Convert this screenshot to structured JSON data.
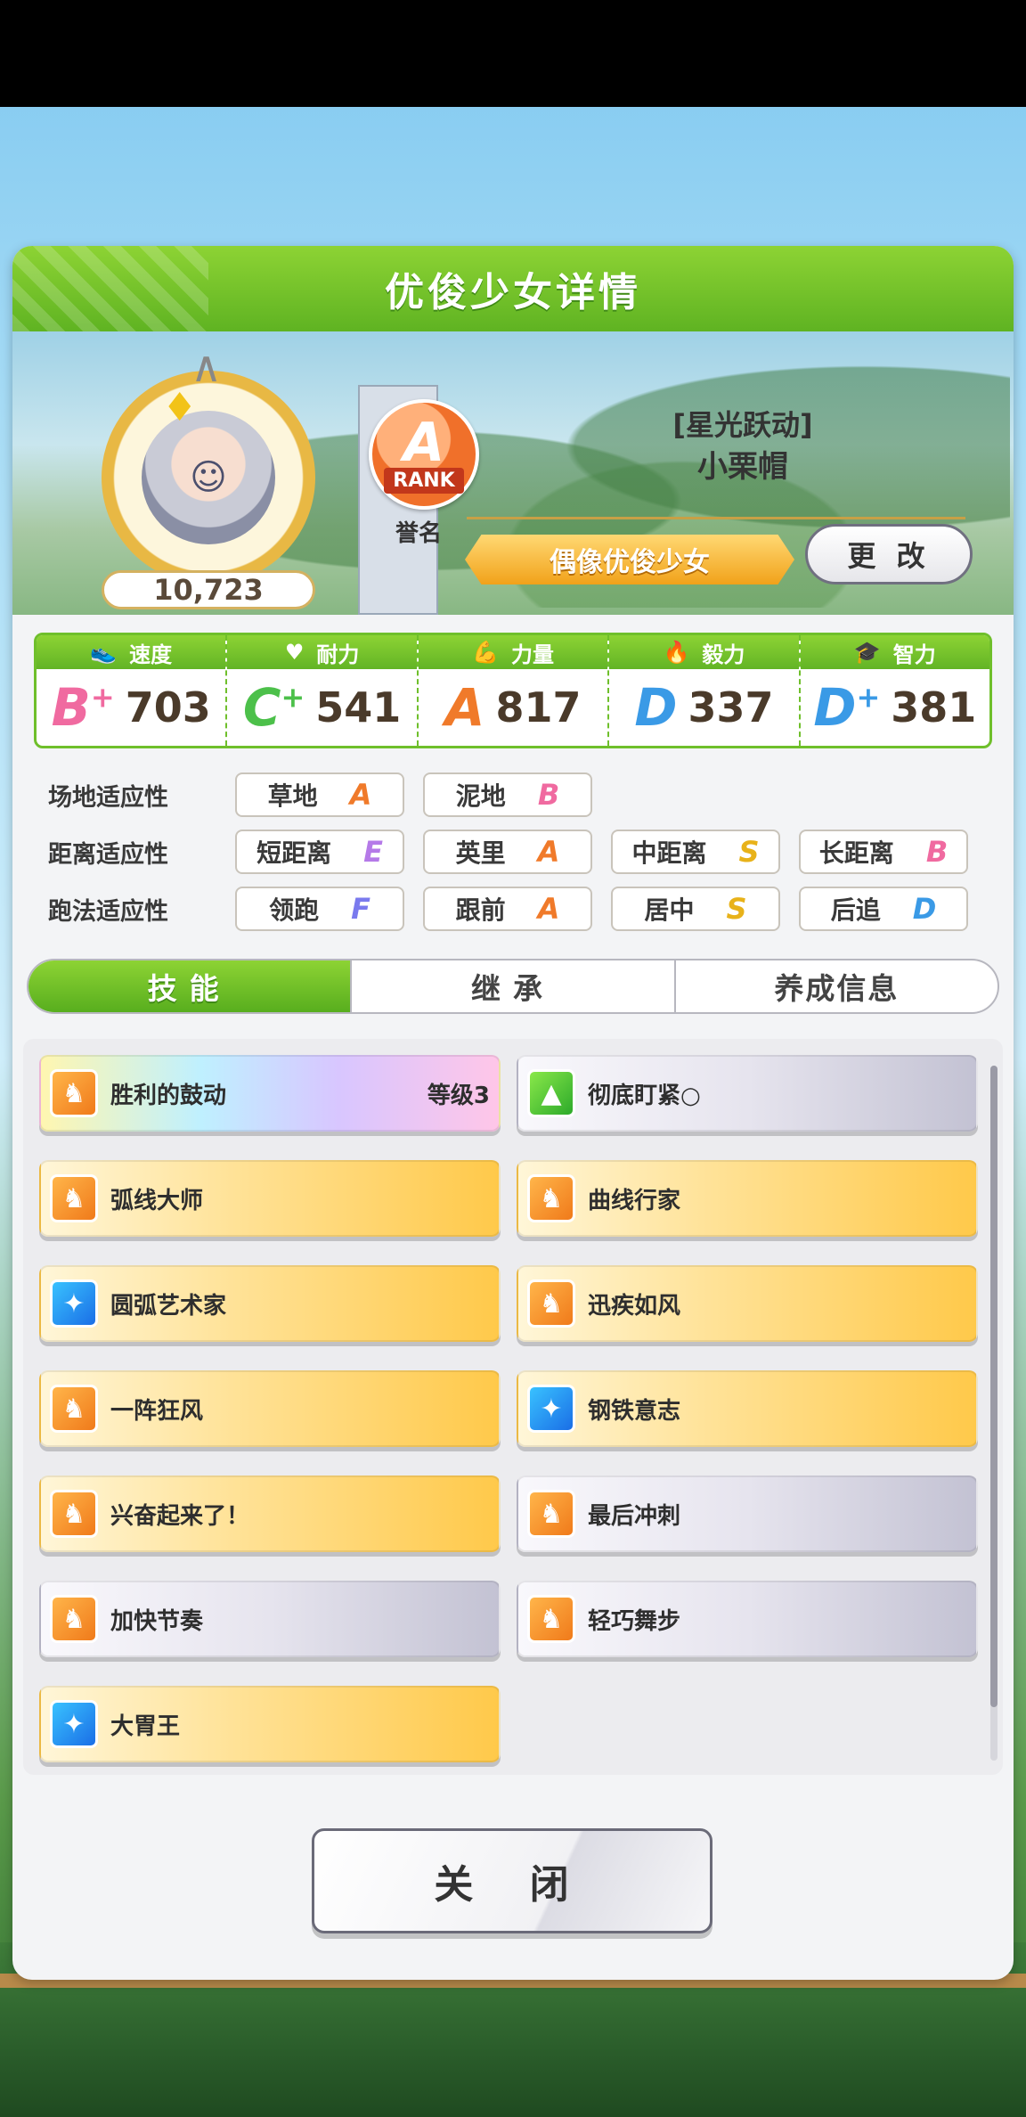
{
  "header": {
    "title": "优俊少女详情"
  },
  "profile": {
    "rating": "10,723",
    "rank_letter": "A",
    "rank_word": "RANK",
    "honor_label": "誉名",
    "outfit": "[星光跃动]",
    "name": "小栗帽",
    "title": "偶像优俊少女",
    "change_label": "更 改"
  },
  "stats": [
    {
      "label": "速度",
      "icon": "shoe-icon",
      "grade": "B",
      "plus": "+",
      "value": "703",
      "color": "#f06aa0"
    },
    {
      "label": "耐力",
      "icon": "heart-icon",
      "grade": "C",
      "plus": "+",
      "value": "541",
      "color": "#4cc04a"
    },
    {
      "label": "力量",
      "icon": "muscle-icon",
      "grade": "A",
      "plus": "",
      "value": "817",
      "color": "#f07a2a"
    },
    {
      "label": "毅力",
      "icon": "flame-icon",
      "grade": "D",
      "plus": "",
      "value": "337",
      "color": "#3a9ae6"
    },
    {
      "label": "智力",
      "icon": "graduation-cap-icon",
      "grade": "D",
      "plus": "+",
      "value": "381",
      "color": "#3a9ae6"
    }
  ],
  "aptitude": {
    "track": {
      "label": "场地适应性",
      "items": [
        {
          "name": "草地",
          "grade": "A"
        },
        {
          "name": "泥地",
          "grade": "B"
        }
      ]
    },
    "distance": {
      "label": "距离适应性",
      "items": [
        {
          "name": "短距离",
          "grade": "E"
        },
        {
          "name": "英里",
          "grade": "A"
        },
        {
          "name": "中距离",
          "grade": "S"
        },
        {
          "name": "长距离",
          "grade": "B"
        }
      ]
    },
    "style": {
      "label": "跑法适应性",
      "items": [
        {
          "name": "领跑",
          "grade": "F"
        },
        {
          "name": "跟前",
          "grade": "A"
        },
        {
          "name": "居中",
          "grade": "S"
        },
        {
          "name": "后追",
          "grade": "D"
        }
      ]
    }
  },
  "tabs": [
    "技能",
    "继承",
    "养成信息"
  ],
  "skills": [
    {
      "name": "胜利的鼓动",
      "level": "等级3",
      "style": "rainbow",
      "icon": "horse-rearing-icon",
      "icon_color": "orange"
    },
    {
      "name": "彻底盯紧○",
      "level": "",
      "style": "grey",
      "icon": "green-flame-icon",
      "icon_color": "green"
    },
    {
      "name": "弧线大师",
      "level": "",
      "style": "gold",
      "icon": "horse-rearing-icon",
      "icon_color": "orange"
    },
    {
      "name": "曲线行家",
      "level": "",
      "style": "gold",
      "icon": "horse-rearing-icon",
      "icon_color": "orange"
    },
    {
      "name": "圆弧艺术家",
      "level": "",
      "style": "gold",
      "icon": "sparkle-icon",
      "icon_color": "blue"
    },
    {
      "name": "迅疾如风",
      "level": "",
      "style": "gold",
      "icon": "horse-rearing-icon",
      "icon_color": "orange"
    },
    {
      "name": "一阵狂风",
      "level": "",
      "style": "gold",
      "icon": "horse-rearing-icon",
      "icon_color": "orange"
    },
    {
      "name": "钢铁意志",
      "level": "",
      "style": "gold",
      "icon": "sparkle-icon",
      "icon_color": "blue"
    },
    {
      "name": "兴奋起来了！",
      "level": "",
      "style": "gold",
      "icon": "horse-rearing-icon",
      "icon_color": "orange"
    },
    {
      "name": "最后冲刺",
      "level": "",
      "style": "grey",
      "icon": "horse-rearing-icon",
      "icon_color": "orange"
    },
    {
      "name": "加快节奏",
      "level": "",
      "style": "grey",
      "icon": "horse-rearing-icon",
      "icon_color": "orange"
    },
    {
      "name": "轻巧舞步",
      "level": "",
      "style": "grey",
      "icon": "horse-rearing-icon",
      "icon_color": "orange"
    },
    {
      "name": "大胃王",
      "level": "",
      "style": "gold",
      "icon": "sparkle-icon",
      "icon_color": "blue"
    }
  ],
  "close_label": "关 闭"
}
